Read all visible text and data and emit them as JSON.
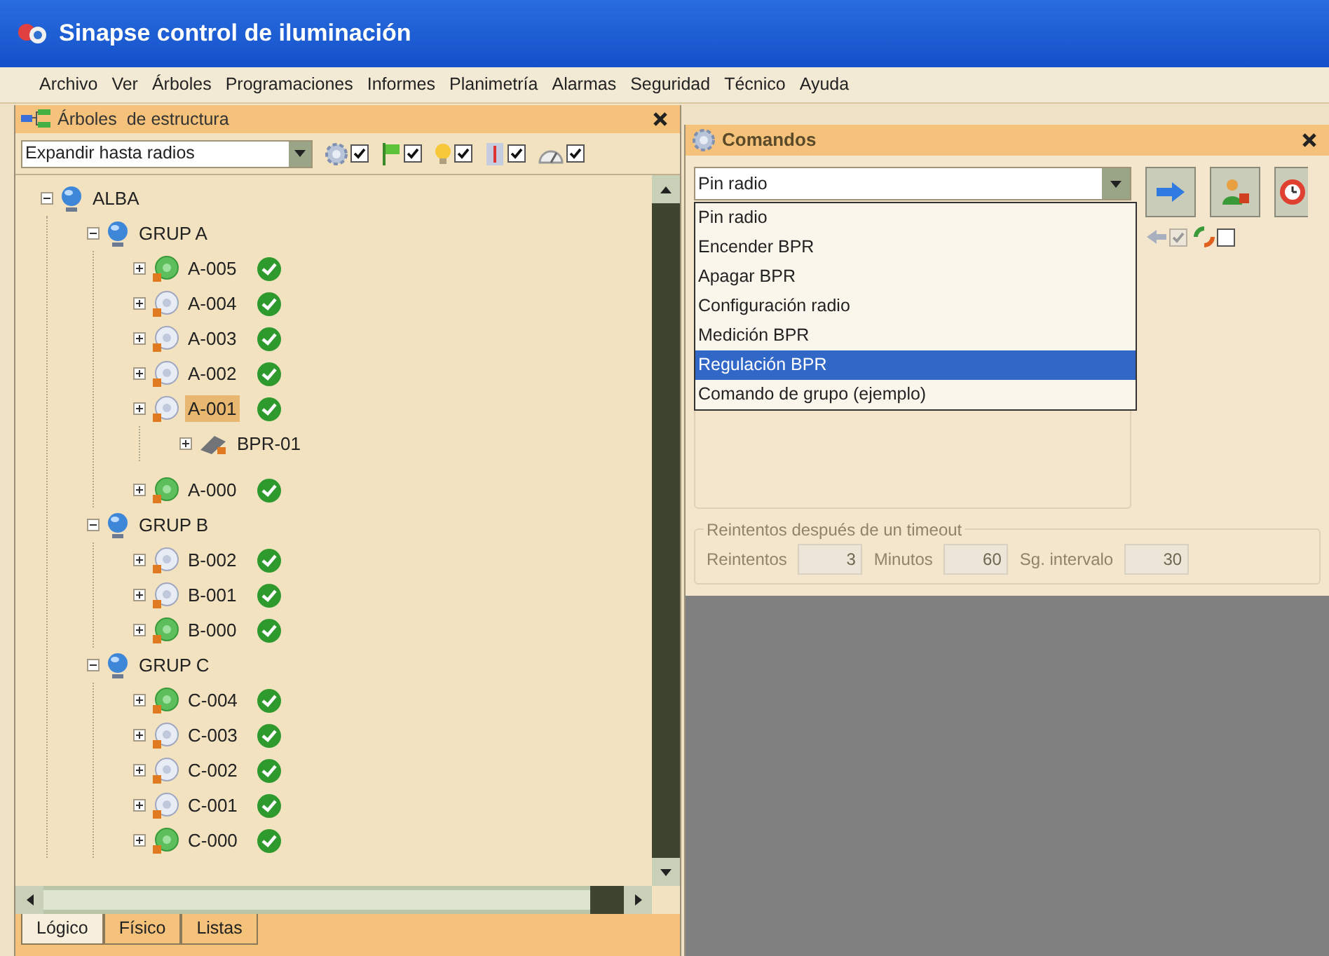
{
  "window": {
    "title": "Sinapse control de iluminación"
  },
  "menu": [
    "Archivo",
    "Ver",
    "Árboles",
    "Programaciones",
    "Informes",
    "Planimetría",
    "Alarmas",
    "Seguridad",
    "Técnico",
    "Ayuda"
  ],
  "tree_panel": {
    "title": "Árboles  de estructura",
    "expand_select": {
      "value": "Expandir hasta radios"
    },
    "filters": [
      {
        "kind": "gear",
        "checked": true
      },
      {
        "kind": "flag",
        "checked": true
      },
      {
        "kind": "bulb",
        "checked": true
      },
      {
        "kind": "thermo",
        "checked": true
      },
      {
        "kind": "gauge",
        "checked": true
      }
    ],
    "tree": [
      {
        "kind": "group",
        "label": "ALBA",
        "expanded": true,
        "children": [
          {
            "kind": "group",
            "label": "GRUP A",
            "expanded": true,
            "children": [
              {
                "kind": "radio",
                "label": "A-005",
                "active": true,
                "ok": true,
                "selected": false
              },
              {
                "kind": "radio",
                "label": "A-004",
                "active": false,
                "ok": true,
                "selected": false
              },
              {
                "kind": "radio",
                "label": "A-003",
                "active": false,
                "ok": true,
                "selected": false
              },
              {
                "kind": "radio",
                "label": "A-002",
                "active": false,
                "ok": true,
                "selected": false
              },
              {
                "kind": "radio",
                "label": "A-001",
                "active": false,
                "ok": true,
                "selected": true,
                "children": [
                  {
                    "kind": "device",
                    "label": "BPR-01"
                  }
                ]
              },
              {
                "kind": "radio",
                "label": "A-000",
                "active": true,
                "ok": true,
                "selected": false
              }
            ]
          },
          {
            "kind": "group",
            "label": "GRUP B",
            "expanded": true,
            "children": [
              {
                "kind": "radio",
                "label": "B-002",
                "active": false,
                "ok": true,
                "selected": false
              },
              {
                "kind": "radio",
                "label": "B-001",
                "active": false,
                "ok": true,
                "selected": false
              },
              {
                "kind": "radio",
                "label": "B-000",
                "active": true,
                "ok": true,
                "selected": false
              }
            ]
          },
          {
            "kind": "group",
            "label": "GRUP C",
            "expanded": true,
            "children": [
              {
                "kind": "radio",
                "label": "C-004",
                "active": true,
                "ok": true,
                "selected": false
              },
              {
                "kind": "radio",
                "label": "C-003",
                "active": false,
                "ok": true,
                "selected": false
              },
              {
                "kind": "radio",
                "label": "C-002",
                "active": false,
                "ok": true,
                "selected": false
              },
              {
                "kind": "radio",
                "label": "C-001",
                "active": false,
                "ok": true,
                "selected": false
              },
              {
                "kind": "radio",
                "label": "C-000",
                "active": true,
                "ok": true,
                "selected": false
              }
            ]
          }
        ]
      }
    ],
    "tabs": [
      {
        "label": "Lógico",
        "selected": true
      },
      {
        "label": "Físico",
        "selected": false
      },
      {
        "label": "Listas",
        "selected": false
      }
    ]
  },
  "commands_panel": {
    "title": "Comandos",
    "command_select": {
      "value": "Pin radio",
      "expanded": true
    },
    "options": [
      {
        "label": "Pin radio",
        "selected": false
      },
      {
        "label": "Encender BPR",
        "selected": false
      },
      {
        "label": "Apagar BPR",
        "selected": false
      },
      {
        "label": "Configuración radio",
        "selected": false
      },
      {
        "label": "Medición BPR",
        "selected": false
      },
      {
        "label": "Regulación BPR",
        "selected": true
      },
      {
        "label": "Comando de grupo (ejemplo)",
        "selected": false
      }
    ],
    "options_checks": [
      {
        "kind": "arrow",
        "checked": true
      },
      {
        "kind": "refresh",
        "checked": false
      }
    ],
    "retries": {
      "title": "Reintentos después de un timeout",
      "fields": [
        {
          "label": "Reintentos",
          "value": "3"
        },
        {
          "label": "Minutos",
          "value": "60"
        },
        {
          "label": "Sg. intervalo",
          "value": "30"
        }
      ]
    }
  }
}
